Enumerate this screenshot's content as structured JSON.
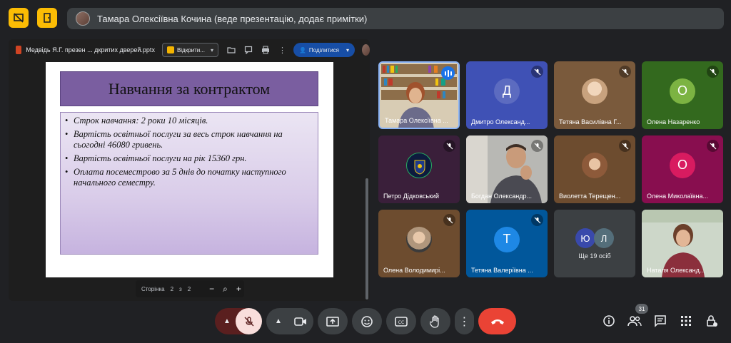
{
  "topbar": {
    "presenter_text": "Тамара Олексіївна Кочина (веде презентацію, додає примітки)"
  },
  "presentation": {
    "filename": "Медвідь Я.Г. презен ... дкритих дверей.pptx",
    "open_label": "Відкрити...",
    "share_label": "Поділитися",
    "slide": {
      "title": "Навчання за контрактом",
      "bullets": [
        "Строк навчання: 2 роки 10 місяців.",
        " Вартість освітньої послуги за весь строк навчання на сьогодні 46080 гривень.",
        "Вартість освітньої послуги на рік 15360 грн.",
        "Оплата посеместрово за 5 днів до початку наступного начального семестру."
      ]
    },
    "pager": {
      "page_label": "Сторінка",
      "current": "2",
      "of": "з",
      "total": "2"
    }
  },
  "participants": [
    {
      "name": "Тамара Олексіївна ...",
      "type": "photo",
      "speaking": true
    },
    {
      "name": "Дмитро Олександ...",
      "type": "letter",
      "letter": "Д",
      "bg": "#3f51b5",
      "avatar": "#5c6bc0"
    },
    {
      "name": "Тетяна Василівна Г...",
      "type": "photo",
      "bg": "#7a5a3c"
    },
    {
      "name": "Олена Назаренко",
      "type": "letter",
      "letter": "О",
      "bg": "#33691e",
      "avatar": "#7cb342"
    },
    {
      "name": "Петро Дідковський",
      "type": "logo",
      "bg": "#3a1f3a"
    },
    {
      "name": "Богдан Олександр...",
      "type": "video"
    },
    {
      "name": "Виолетта Терещен...",
      "type": "photo",
      "bg": "#6d4c2f"
    },
    {
      "name": "Олена Миколаївна...",
      "type": "letter",
      "letter": "О",
      "bg": "#880e4f",
      "avatar": "#d81b60"
    },
    {
      "name": "Олена Володимирі...",
      "type": "photo",
      "bg": "#6d4c2f"
    },
    {
      "name": "Тетяна Валеріївна ...",
      "type": "letter",
      "letter": "Т",
      "bg": "#01579b",
      "avatar": "#1e88e5"
    },
    {
      "name": "",
      "type": "more",
      "letters": [
        "Ю",
        "Л"
      ],
      "more_text": "Ще 19 осіб"
    },
    {
      "name": "Наталя Олександ...",
      "type": "video2"
    }
  ],
  "controls": {
    "participant_count": "31"
  },
  "colors": {
    "background": "#202124",
    "accent_yellow": "#fbbc04",
    "end_call": "#ea4335",
    "mic_off": "#f9dedc",
    "share_blue": "#174ea6"
  }
}
